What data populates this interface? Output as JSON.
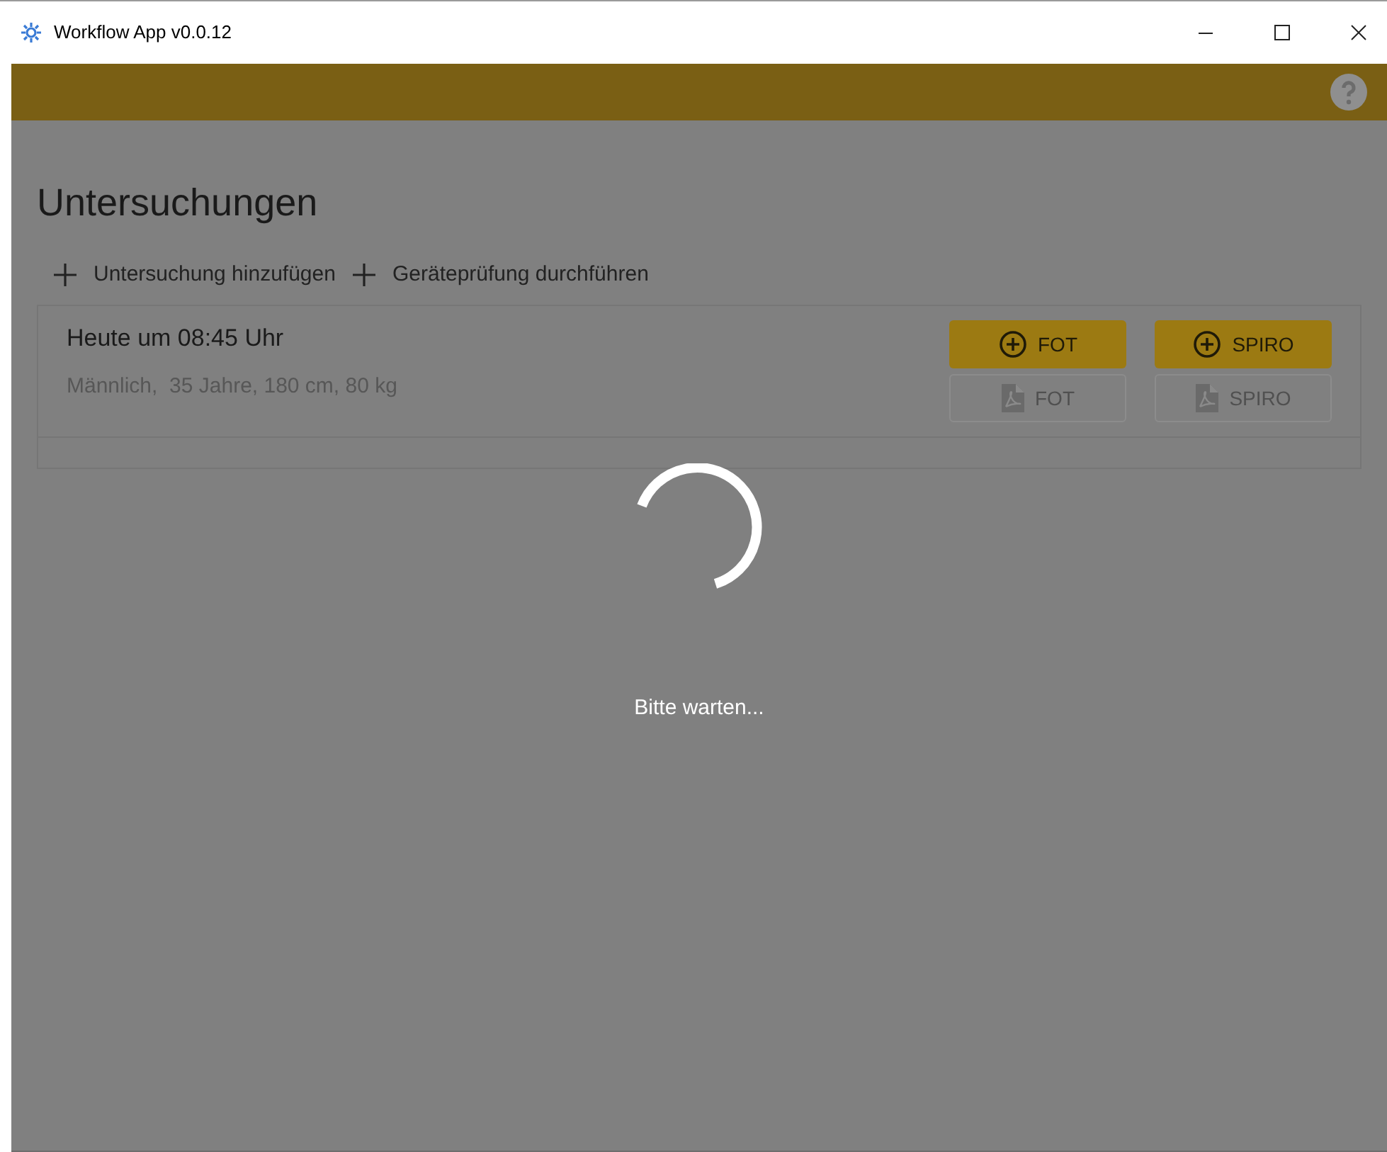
{
  "window": {
    "title": "Workflow App v0.0.12"
  },
  "page": {
    "title": "Untersuchungen"
  },
  "actions": [
    {
      "label": "Untersuchung hinzufügen"
    },
    {
      "label": "Geräteprüfung durchführen"
    }
  ],
  "examinations": [
    {
      "time": "Heute um 08:45 Uhr",
      "details": "Männlich,  35 Jahre, 180 cm, 80 kg",
      "buttons": [
        {
          "kind": "add",
          "label": "FOT",
          "disabled": false
        },
        {
          "kind": "add",
          "label": "SPIRO",
          "disabled": false
        },
        {
          "kind": "pdf",
          "label": "FOT",
          "disabled": true
        },
        {
          "kind": "pdf",
          "label": "SPIRO",
          "disabled": true
        }
      ]
    }
  ],
  "loading": {
    "message": "Bitte warten..."
  }
}
